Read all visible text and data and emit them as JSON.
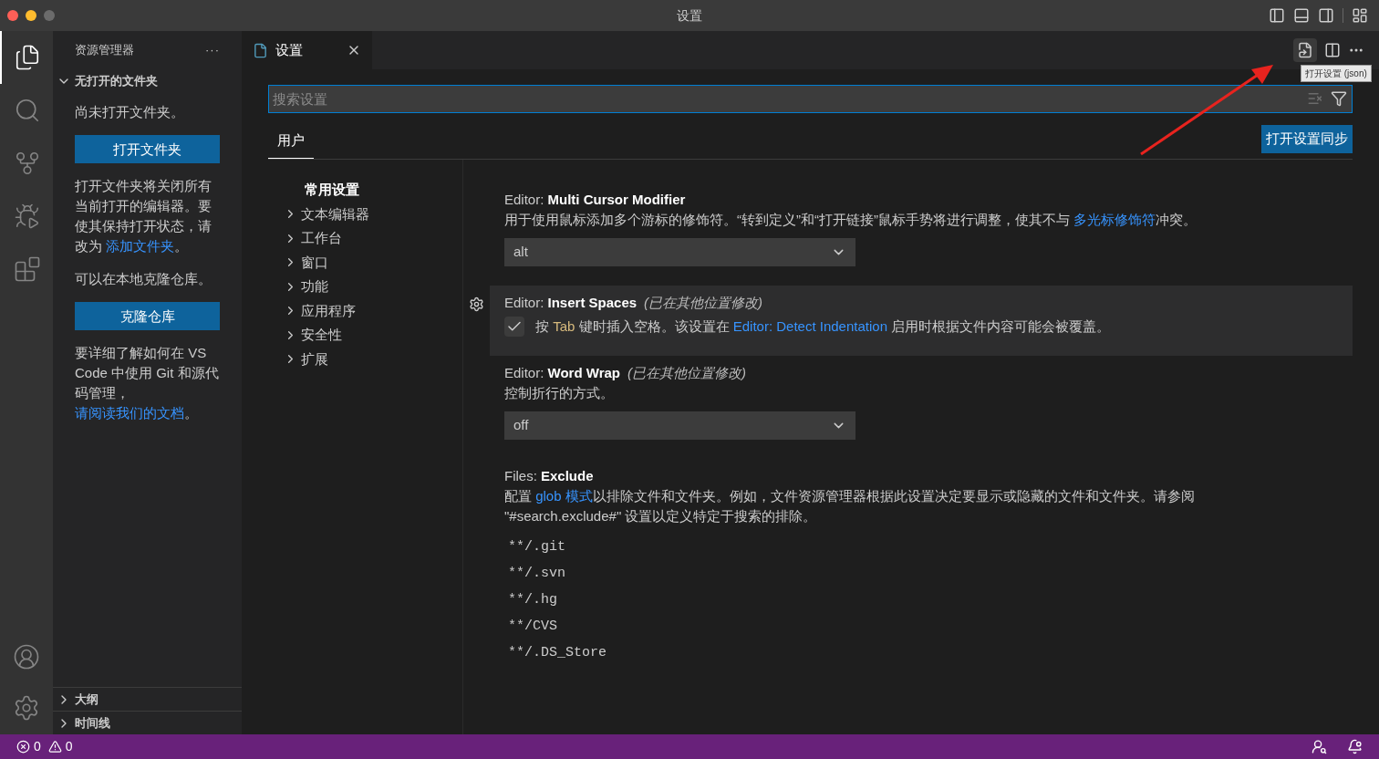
{
  "window": {
    "title": "设置"
  },
  "activity_bar": {
    "items": [
      {
        "kind": "files",
        "selected": true
      },
      {
        "kind": "search",
        "selected": false
      },
      {
        "kind": "source_control",
        "selected": false
      },
      {
        "kind": "run",
        "selected": false
      },
      {
        "kind": "extensions",
        "selected": false
      }
    ]
  },
  "sidebar": {
    "title": "资源管理器",
    "more": "···",
    "section": {
      "label": "无打开的文件夹",
      "expanded": true
    },
    "paragraphs": [
      {
        "kind": "text",
        "segments": [
          {
            "kind": "text",
            "text": "尚未打开文件夹。"
          }
        ]
      },
      {
        "kind": "button",
        "label": "打开文件夹"
      },
      {
        "kind": "text",
        "segments": [
          {
            "kind": "text",
            "text": "打开文件夹将关闭所有当前打开的编辑器。要使其保持打开状态，请改为 "
          },
          {
            "kind": "link",
            "text": "添加文件夹"
          },
          {
            "kind": "text",
            "text": "。"
          }
        ]
      },
      {
        "kind": "text",
        "segments": [
          {
            "kind": "text",
            "text": "可以在本地克隆仓库。"
          }
        ]
      },
      {
        "kind": "button",
        "label": "克隆仓库"
      },
      {
        "kind": "text",
        "segments": [
          {
            "kind": "text",
            "text": "要详细了解如何在 VS Code 中使用 Git 和源代码管理，"
          },
          {
            "kind": "link",
            "text": "请阅读我们的文档"
          },
          {
            "kind": "text",
            "text": "。"
          }
        ]
      }
    ],
    "bottom_sections": [
      {
        "label": "大纲",
        "expanded": false
      },
      {
        "label": "时间线",
        "expanded": false
      }
    ]
  },
  "editor_tab": {
    "label": "设置"
  },
  "tooltip": "打开设置 (json)",
  "settings": {
    "search": {
      "placeholder": "搜索设置"
    },
    "scope_tabs": [
      {
        "label": "用户",
        "selected": true
      }
    ],
    "sync_button": "打开设置同步",
    "toc": [
      {
        "label": "常用设置",
        "selected": true,
        "expandable": false
      },
      {
        "label": "文本编辑器",
        "selected": false,
        "expandable": true
      },
      {
        "label": "工作台",
        "selected": false,
        "expandable": true
      },
      {
        "label": "窗口",
        "selected": false,
        "expandable": true
      },
      {
        "label": "功能",
        "selected": false,
        "expandable": true
      },
      {
        "label": "应用程序",
        "selected": false,
        "expandable": true
      },
      {
        "label": "安全性",
        "selected": false,
        "expandable": true
      },
      {
        "label": "扩展",
        "selected": false,
        "expandable": true
      }
    ],
    "items": [
      {
        "kind": "dropdown",
        "category": "Editor: ",
        "name": "Multi Cursor Modifier",
        "selected": false,
        "description": [
          {
            "kind": "text",
            "text": "用于使用鼠标添加多个游标的修饰符。“转到定义”和“打开链接”鼠标手势将进行调整，使其不与 "
          },
          {
            "kind": "link",
            "text": "多光标修饰符"
          },
          {
            "kind": "text",
            "text": "冲突。"
          }
        ],
        "value": "alt"
      },
      {
        "kind": "checkbox",
        "category": "Editor: ",
        "name": "Insert Spaces",
        "modified": "(已在其他位置修改)",
        "selected": true,
        "checked": true,
        "description": [
          {
            "kind": "text",
            "text": "按 "
          },
          {
            "kind": "code",
            "text": "Tab"
          },
          {
            "kind": "text",
            "text": " 键时插入空格。该设置在 "
          },
          {
            "kind": "link",
            "text": "Editor: Detect Indentation"
          },
          {
            "kind": "text",
            "text": " 启用时根据文件内容可能会被覆盖。"
          }
        ]
      },
      {
        "kind": "dropdown",
        "category": "Editor: ",
        "name": "Word Wrap",
        "modified": "(已在其他位置修改)",
        "selected": false,
        "description": [
          {
            "kind": "text",
            "text": "控制折行的方式。"
          }
        ],
        "value": "off"
      },
      {
        "kind": "list",
        "category": "Files: ",
        "name": "Exclude",
        "selected": false,
        "description": [
          {
            "kind": "text",
            "text": "配置 "
          },
          {
            "kind": "link",
            "text": "glob 模式"
          },
          {
            "kind": "text",
            "text": "以排除文件和文件夹。例如，文件资源管理器根据此设置决定要显示或隐藏的文件和文件夹。请参阅 \"#search.exclude#\" 设置以定义特定于搜索的排除。"
          }
        ],
        "entries": [
          "**/.git",
          "**/.svn",
          "**/.hg",
          "**/CVS",
          "**/.DS_Store"
        ]
      }
    ]
  },
  "status_bar": {
    "errors": "0",
    "warnings": "0"
  }
}
